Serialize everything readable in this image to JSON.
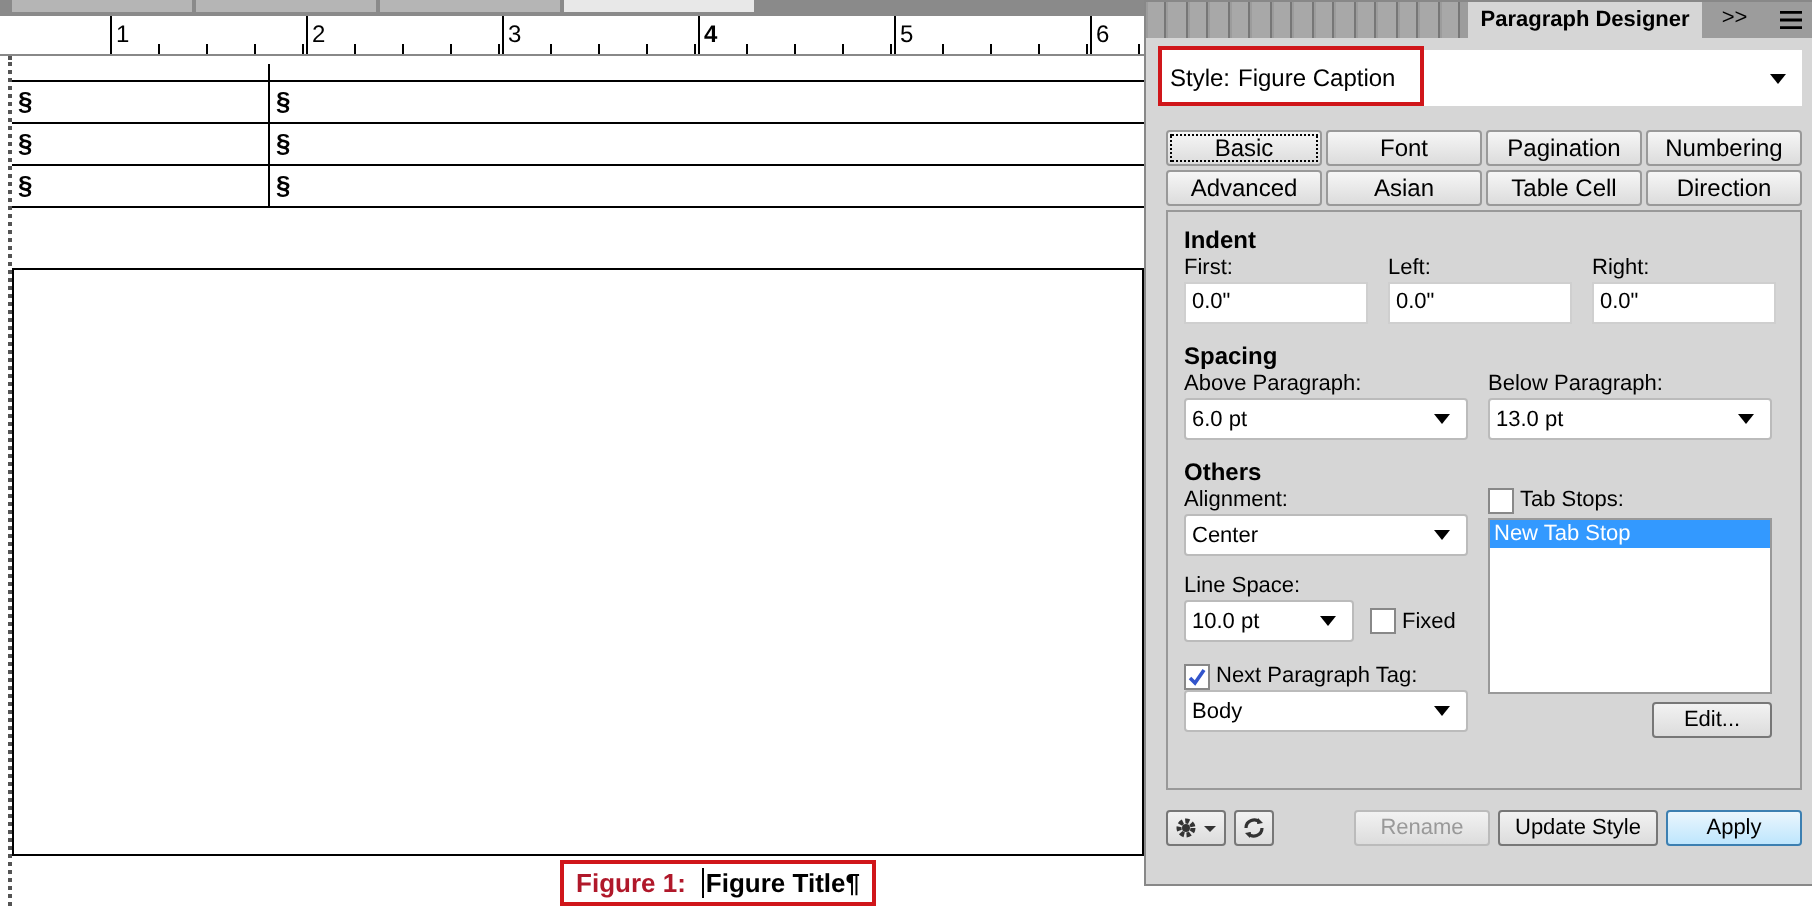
{
  "document_tabs": [
    {
      "selected": false
    },
    {
      "selected": false
    },
    {
      "selected": false
    },
    {
      "selected": true
    }
  ],
  "ruler": {
    "marks": [
      {
        "label": "1",
        "bold": false
      },
      {
        "label": "2",
        "bold": false
      },
      {
        "label": "3",
        "bold": false
      },
      {
        "label": "4",
        "bold": true
      },
      {
        "label": "5",
        "bold": false
      },
      {
        "label": "6",
        "bold": false
      }
    ]
  },
  "table": {
    "rows": [
      [
        "§",
        "§"
      ],
      [
        "§",
        "§"
      ],
      [
        "§",
        "§"
      ]
    ]
  },
  "caption": {
    "label": "Figure 1:",
    "title": "Figure Title¶"
  },
  "panel": {
    "title": "Paragraph Designer",
    "overflow": ">>",
    "style_label": "Style:",
    "style_value": "Figure Caption",
    "tabs": [
      {
        "label": "Basic",
        "selected": true
      },
      {
        "label": "Font",
        "selected": false
      },
      {
        "label": "Pagination",
        "selected": false
      },
      {
        "label": "Numbering",
        "selected": false
      },
      {
        "label": "Advanced",
        "selected": false
      },
      {
        "label": "Asian",
        "selected": false
      },
      {
        "label": "Table Cell",
        "selected": false
      },
      {
        "label": "Direction",
        "selected": false
      }
    ],
    "indent": {
      "heading": "Indent",
      "fields": [
        {
          "label": "First:",
          "value": "0.0\""
        },
        {
          "label": "Left:",
          "value": "0.0\""
        },
        {
          "label": "Right:",
          "value": "0.0\""
        }
      ]
    },
    "spacing": {
      "heading": "Spacing",
      "fields": [
        {
          "label": "Above Paragraph:",
          "value": "6.0 pt"
        },
        {
          "label": "Below Paragraph:",
          "value": "13.0 pt"
        }
      ]
    },
    "others": {
      "heading": "Others",
      "alignment_label": "Alignment:",
      "alignment": "Center",
      "line_space_label": "Line Space:",
      "line_space": "10.0 pt",
      "fixed": {
        "label": "Fixed",
        "checked": false
      },
      "next_tag": {
        "label": "Next Paragraph Tag:",
        "checked": true
      },
      "next_tag_value": "Body",
      "tab_stops": {
        "label": "Tab Stops:",
        "checked": false
      },
      "tab_stop_items": [
        {
          "label": "New Tab Stop",
          "selected": true
        }
      ],
      "edit": "Edit..."
    },
    "buttons": [
      {
        "label": "Rename",
        "disabled": true,
        "default": false
      },
      {
        "label": "Update Style",
        "disabled": false,
        "default": false
      },
      {
        "label": "Apply",
        "disabled": false,
        "default": true
      }
    ]
  }
}
